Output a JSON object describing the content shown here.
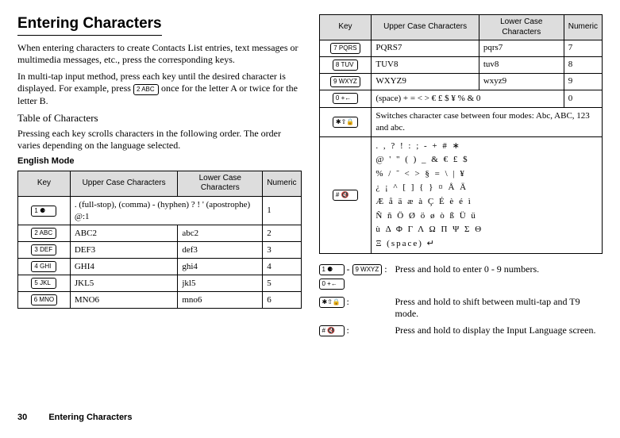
{
  "title": "Entering Characters",
  "para1": "When entering characters to create Contacts List entries, text messages or multimedia messages, etc., press the corresponding keys.",
  "para2a": "In multi-tap input method, press each key until the desired character is displayed. For example, press ",
  "para2b": " once for the letter A or twice for the letter B.",
  "tocTitle": "Table of Characters",
  "tocText": "Pressing each key scrolls characters in the following order. The order varies depending on the language selected.",
  "modeTitle": "English Mode",
  "headers": {
    "key": "Key",
    "upper": "Upper Case Characters",
    "lower": "Lower Case Characters",
    "numeric": "Numeric"
  },
  "leftRows": [
    {
      "keycap": "1 ⚈",
      "upperSpan": ". (full-stop), (comma) - (hyphen) ? ! ' (apostrophe) @:1",
      "numeric": "1"
    },
    {
      "keycap": "2 ABC",
      "upper": "ABC2",
      "lower": "abc2",
      "numeric": "2"
    },
    {
      "keycap": "3 DEF",
      "upper": "DEF3",
      "lower": "def3",
      "numeric": "3"
    },
    {
      "keycap": "4 GHI",
      "upper": "GHI4",
      "lower": "ghi4",
      "numeric": "4"
    },
    {
      "keycap": "5 JKL",
      "upper": "JKL5",
      "lower": "jkl5",
      "numeric": "5"
    },
    {
      "keycap": "6 MNO",
      "upper": "MNO6",
      "lower": "mno6",
      "numeric": "6"
    }
  ],
  "rightRows": [
    {
      "keycap": "7 PQRS",
      "upper": "PQRS7",
      "lower": "pqrs7",
      "numeric": "7"
    },
    {
      "keycap": "8 TUV",
      "upper": "TUV8",
      "lower": "tuv8",
      "numeric": "8"
    },
    {
      "keycap": "9 WXYZ",
      "upper": "WXYZ9",
      "lower": "wxyz9",
      "numeric": "9"
    },
    {
      "keycap": "0 +←",
      "upperSpan": "(space) + = < > € £ $ ¥ % & 0",
      "numeric": "0"
    },
    {
      "keycap": "✱⇧🔒",
      "fullSpan": "Switches character case between four modes: Abc, ABC, 123 and abc."
    },
    {
      "keycap": "# 🔇",
      "fullSpanSym": ".  ,  ?  !  :  ;  -  +  #  ∗\n@  '  \"  (  )  _  &  €  £  $\n%  /  ˜  <  >  §  =  \\  |  ¥\n¿  ¡  ^  [  ]  {  }  ¤  Å  Ä\nÆ  å  ä  æ  à  Ç  É  è  é  ì\nÑ  ñ  Ö  Ø  ö  ø  ò  ß  Ü  ü\n ù  Δ  Φ  Γ  Λ  Ω  Π  Ψ  Σ  Θ\nΞ (space) ↵"
    }
  ],
  "notes": [
    {
      "keys": [
        "1 ⚈",
        "-",
        "9 WXYZ"
      ],
      "colon": ":",
      "text": "Press and hold to enter 0 - 9 numbers.",
      "extraKey": "0 +←"
    },
    {
      "keys": [
        "✱⇧🔒"
      ],
      "colon": ":",
      "text": "Press and hold to shift between multi-tap and T9 mode."
    },
    {
      "keys": [
        "# 🔇"
      ],
      "colon": ":",
      "text": "Press and hold to display the Input Language screen."
    }
  ],
  "footer": {
    "page": "30",
    "section": "Entering Characters"
  },
  "inlineKey": "2 ABC"
}
